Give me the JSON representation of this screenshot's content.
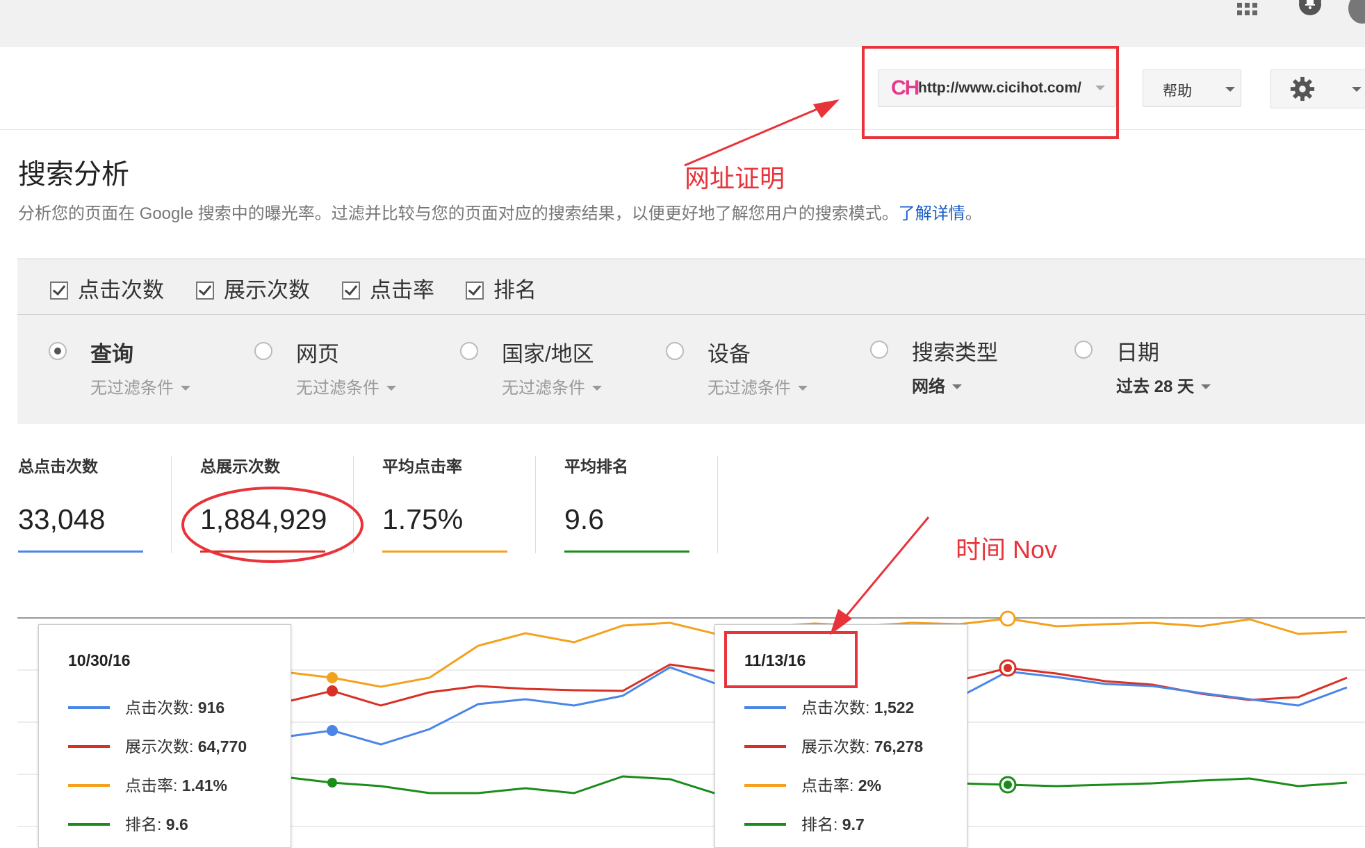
{
  "site": {
    "logo": "CH",
    "url": "http://www.cicihot.com/"
  },
  "help_label": "帮助",
  "annotations": {
    "url_proof": "网址证明",
    "time": "时间 Nov"
  },
  "page": {
    "title": "搜索分析",
    "description": "分析您的页面在 Google 搜索中的曝光率。过滤并比较与您的页面对应的搜索结果，以便更好地了解您用户的搜索模式。",
    "learn_more": "了解详情",
    "period": "。"
  },
  "metrics": [
    {
      "label": "点击次数",
      "checked": true
    },
    {
      "label": "展示次数",
      "checked": true
    },
    {
      "label": "点击率",
      "checked": true
    },
    {
      "label": "排名",
      "checked": true
    }
  ],
  "dimensions": [
    {
      "label": "查询",
      "sub": "无过滤条件",
      "selected": true
    },
    {
      "label": "网页",
      "sub": "无过滤条件",
      "selected": false
    },
    {
      "label": "国家/地区",
      "sub": "无过滤条件",
      "selected": false
    },
    {
      "label": "设备",
      "sub": "无过滤条件",
      "selected": false
    },
    {
      "label": "搜索类型",
      "sub": "网络",
      "selected": false
    },
    {
      "label": "日期",
      "sub": "过去 28 天",
      "selected": false
    }
  ],
  "stats": [
    {
      "title": "总点击次数",
      "value": "33,048",
      "color": "#4a86e8"
    },
    {
      "title": "总展示次数",
      "value": "1,884,929",
      "color": "#d93025"
    },
    {
      "title": "平均点击率",
      "value": "1.75%",
      "color": "#f4a11d"
    },
    {
      "title": "平均排名",
      "value": "9.6",
      "color": "#1a8c1a"
    }
  ],
  "tooltips": [
    {
      "date": "10/30/16",
      "rows": [
        {
          "label": "点击次数",
          "value": "916",
          "color": "#4a86e8"
        },
        {
          "label": "展示次数",
          "value": "64,770",
          "color": "#d93025"
        },
        {
          "label": "点击率",
          "value": "1.41%",
          "color": "#f4a11d"
        },
        {
          "label": "排名",
          "value": "9.6",
          "color": "#1a8c1a"
        }
      ]
    },
    {
      "date": "11/13/16",
      "rows": [
        {
          "label": "点击次数",
          "value": "1,522",
          "color": "#4a86e8"
        },
        {
          "label": "展示次数",
          "value": "76,278",
          "color": "#d93025"
        },
        {
          "label": "点击率",
          "value": "2%",
          "color": "#f4a11d"
        },
        {
          "label": "排名",
          "value": "9.7",
          "color": "#1a8c1a"
        }
      ]
    }
  ]
}
